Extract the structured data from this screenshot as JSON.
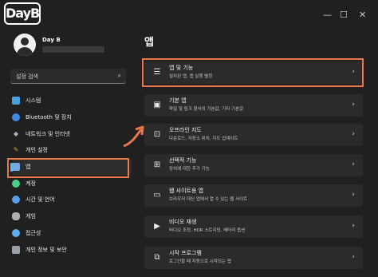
{
  "logo_text": "DayB",
  "window": {
    "minimize": "—",
    "maximize": "☐",
    "close": "✕"
  },
  "user": {
    "name": "Day B"
  },
  "search": {
    "placeholder": "설정 검색",
    "icon": "search-icon"
  },
  "sidebar": {
    "items": [
      {
        "label": "시스템",
        "icon": "monitor-icon",
        "color": "#4aa3df",
        "active": false
      },
      {
        "label": "Bluetooth 및 장치",
        "icon": "bluetooth-icon",
        "color": "#3d8be0",
        "active": false
      },
      {
        "label": "네트워크 및 인터넷",
        "icon": "wifi-icon",
        "color": "#9fb7d0",
        "active": false
      },
      {
        "label": "개인 설정",
        "icon": "brush-icon",
        "color": "#e0a040",
        "active": false
      },
      {
        "label": "앱",
        "icon": "apps-icon",
        "color": "#7aa9e0",
        "active": true
      },
      {
        "label": "계정",
        "icon": "person-icon",
        "color": "#4ccf8a",
        "active": false
      },
      {
        "label": "시간 및 언어",
        "icon": "globe-clock-icon",
        "color": "#5aa0e8",
        "active": false
      },
      {
        "label": "게임",
        "icon": "gamepad-icon",
        "color": "#b0b0b0",
        "active": false
      },
      {
        "label": "접근성",
        "icon": "accessibility-icon",
        "color": "#5fb0f0",
        "active": false
      },
      {
        "label": "개인 정보 및 보안",
        "icon": "shield-icon",
        "color": "#9aa0a8",
        "active": false
      }
    ]
  },
  "main": {
    "title": "앱",
    "cards": [
      {
        "title": "앱 및 기능",
        "subtitle": "설치된 앱, 앱 실행 별칭",
        "icon": "list-icon"
      },
      {
        "title": "기본 앱",
        "subtitle": "파일 및 링크 형식의 기본값, 기타 기본값",
        "icon": "default-apps-icon"
      },
      {
        "title": "오프라인 지도",
        "subtitle": "다운로드, 저장소 위치, 지도 업데이트",
        "icon": "map-icon"
      },
      {
        "title": "선택적 기능",
        "subtitle": "장치에 대한 추가 기능",
        "icon": "optional-features-icon"
      },
      {
        "title": "웹 사이트용 앱",
        "subtitle": "브라우저 대신 앱에서 열 수 있는 웹 사이트",
        "icon": "website-app-icon"
      },
      {
        "title": "비디오 재생",
        "subtitle": "비디오 조정, HDR 스트리밍, 배터리 옵션",
        "icon": "video-icon"
      },
      {
        "title": "시작 프로그램",
        "subtitle": "로그인할 때 자동으로 시작되는 앱",
        "icon": "startup-icon"
      }
    ]
  },
  "accent_color": "#e8774c"
}
